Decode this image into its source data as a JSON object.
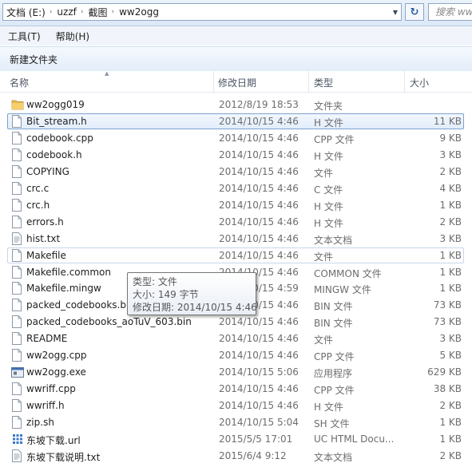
{
  "address": {
    "crumbs": [
      "文档 (E:)",
      "uzzf",
      "截图",
      "ww2ogg"
    ],
    "separator": "›",
    "dropdown_icon": "chevron-down-icon",
    "refresh_glyph": "↻",
    "search_placeholder": "搜索 ww"
  },
  "menu": {
    "items": [
      "工具(T)",
      "帮助(H)"
    ]
  },
  "command_bar": {
    "new_folder": "新建文件夹"
  },
  "columns": {
    "name": "名称",
    "date": "修改日期",
    "type": "类型",
    "size": "大小"
  },
  "files": [
    {
      "name": "ww2ogg019",
      "date": "2012/8/19 18:53",
      "type": "文件夹",
      "size": "",
      "icon": "folder-icon"
    },
    {
      "name": "Bit_stream.h",
      "date": "2014/10/15 4:46",
      "type": "H 文件",
      "size": "11 KB",
      "icon": "file-icon",
      "state": "selected"
    },
    {
      "name": "codebook.cpp",
      "date": "2014/10/15 4:46",
      "type": "CPP 文件",
      "size": "9 KB",
      "icon": "file-icon"
    },
    {
      "name": "codebook.h",
      "date": "2014/10/15 4:46",
      "type": "H 文件",
      "size": "3 KB",
      "icon": "file-icon"
    },
    {
      "name": "COPYING",
      "date": "2014/10/15 4:46",
      "type": "文件",
      "size": "2 KB",
      "icon": "file-icon"
    },
    {
      "name": "crc.c",
      "date": "2014/10/15 4:46",
      "type": "C 文件",
      "size": "4 KB",
      "icon": "file-icon"
    },
    {
      "name": "crc.h",
      "date": "2014/10/15 4:46",
      "type": "H 文件",
      "size": "1 KB",
      "icon": "file-icon"
    },
    {
      "name": "errors.h",
      "date": "2014/10/15 4:46",
      "type": "H 文件",
      "size": "2 KB",
      "icon": "file-icon"
    },
    {
      "name": "hist.txt",
      "date": "2014/10/15 4:46",
      "type": "文本文档",
      "size": "3 KB",
      "icon": "text-file-icon"
    },
    {
      "name": "Makefile",
      "date": "2014/10/15 4:46",
      "type": "文件",
      "size": "1 KB",
      "icon": "file-icon",
      "state": "focus"
    },
    {
      "name": "Makefile.common",
      "date": "2014/10/15 4:46",
      "type": "COMMON 文件",
      "size": "1 KB",
      "icon": "file-icon"
    },
    {
      "name": "Makefile.mingw",
      "date": "2014/10/15 4:59",
      "type": "MINGW 文件",
      "size": "1 KB",
      "icon": "file-icon"
    },
    {
      "name": "packed_codebooks.bin",
      "date": "2014/10/15 4:46",
      "type": "BIN 文件",
      "size": "73 KB",
      "icon": "file-icon"
    },
    {
      "name": "packed_codebooks_aoTuV_603.bin",
      "date": "2014/10/15 4:46",
      "type": "BIN 文件",
      "size": "73 KB",
      "icon": "file-icon"
    },
    {
      "name": "README",
      "date": "2014/10/15 4:46",
      "type": "文件",
      "size": "3 KB",
      "icon": "file-icon"
    },
    {
      "name": "ww2ogg.cpp",
      "date": "2014/10/15 4:46",
      "type": "CPP 文件",
      "size": "5 KB",
      "icon": "file-icon"
    },
    {
      "name": "ww2ogg.exe",
      "date": "2014/10/15 5:06",
      "type": "应用程序",
      "size": "629 KB",
      "icon": "exe-icon"
    },
    {
      "name": "wwriff.cpp",
      "date": "2014/10/15 4:46",
      "type": "CPP 文件",
      "size": "38 KB",
      "icon": "file-icon"
    },
    {
      "name": "wwriff.h",
      "date": "2014/10/15 4:46",
      "type": "H 文件",
      "size": "2 KB",
      "icon": "file-icon"
    },
    {
      "name": "zip.sh",
      "date": "2014/10/15 5:04",
      "type": "SH 文件",
      "size": "1 KB",
      "icon": "file-icon"
    },
    {
      "name": "东坡下载.url",
      "date": "2015/5/5 17:01",
      "type": "UC HTML Docu...",
      "size": "1 KB",
      "icon": "url-icon"
    },
    {
      "name": "东坡下载说明.txt",
      "date": "2015/6/4 9:12",
      "type": "文本文档",
      "size": "2 KB",
      "icon": "text-file-icon"
    }
  ],
  "tooltip": {
    "type_line": "类型: 文件",
    "size_line": "大小: 149 字节",
    "date_line": "修改日期: 2014/10/15 4:46"
  },
  "colors": {
    "selection_border": "#7da2ce",
    "folder": "#e8b94a",
    "link_blue": "#2b5fa8"
  }
}
